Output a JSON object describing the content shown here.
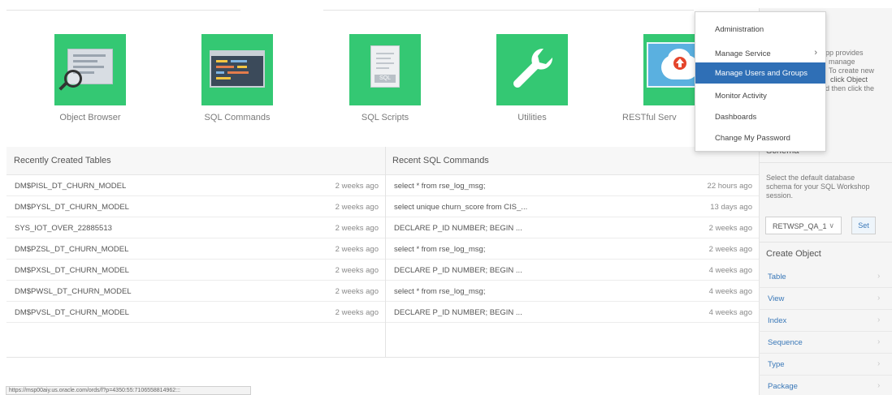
{
  "tiles": [
    {
      "label": "Object Browser",
      "icon": "object-browser-icon"
    },
    {
      "label": "SQL Commands",
      "icon": "sql-commands-icon"
    },
    {
      "label": "SQL Scripts",
      "icon": "sql-scripts-icon"
    },
    {
      "label": "Utilities",
      "icon": "wrench-icon"
    },
    {
      "label": "RESTful Serv",
      "icon": "cloud-upload-icon"
    }
  ],
  "tables_panel": {
    "title": "Recently Created Tables",
    "rows": [
      {
        "name": "DM$PISL_DT_CHURN_MODEL",
        "time": "2 weeks ago"
      },
      {
        "name": "DM$PYSL_DT_CHURN_MODEL",
        "time": "2 weeks ago"
      },
      {
        "name": "SYS_IOT_OVER_22885513",
        "time": "2 weeks ago"
      },
      {
        "name": "DM$PZSL_DT_CHURN_MODEL",
        "time": "2 weeks ago"
      },
      {
        "name": "DM$PXSL_DT_CHURN_MODEL",
        "time": "2 weeks ago"
      },
      {
        "name": "DM$PWSL_DT_CHURN_MODEL",
        "time": "2 weeks ago"
      },
      {
        "name": "DM$PVSL_DT_CHURN_MODEL",
        "time": "2 weeks ago"
      }
    ]
  },
  "commands_panel": {
    "title": "Recent SQL Commands",
    "rows": [
      {
        "name": "select * from rse_log_msg;",
        "time": "22 hours ago"
      },
      {
        "name": "select unique churn_score from CIS_...",
        "time": "13 days ago"
      },
      {
        "name": "DECLARE P_ID NUMBER; BEGIN ...",
        "time": "2 weeks ago"
      },
      {
        "name": "select * from rse_log_msg;",
        "time": "2 weeks ago"
      },
      {
        "name": "DECLARE P_ID NUMBER; BEGIN ...",
        "time": "4 weeks ago"
      },
      {
        "name": "select * from rse_log_msg;",
        "time": "4 weeks ago"
      },
      {
        "name": "DECLARE P_ID NUMBER; BEGIN ...",
        "time": "4 weeks ago"
      }
    ]
  },
  "sidebar": {
    "about_lines": [
      "pp provides",
      "manage",
      "To create new",
      "click Object",
      "d then click the"
    ],
    "schema_title": "Schema",
    "schema_desc": [
      "Select the default database",
      "schema for your SQL Workshop",
      "session."
    ],
    "schema_value": "RETWSP_QA_1",
    "set_label": "Set",
    "create_title": "Create Object",
    "create_links": [
      "Table",
      "View",
      "Index",
      "Sequence",
      "Type",
      "Package"
    ]
  },
  "menu": {
    "items": [
      "Administration",
      "Manage Service",
      "Manage Users and Groups",
      "Monitor Activity",
      "Dashboards",
      "Change My Password"
    ],
    "active_index": 2
  },
  "status_url": "https://msp00aiy.us.oracle.com/ords/f?p=4350:55:7106558814962:::",
  "colors": {
    "tile_green": "#34c873",
    "menu_active": "#2f6fb6",
    "link": "#3a78b8"
  }
}
